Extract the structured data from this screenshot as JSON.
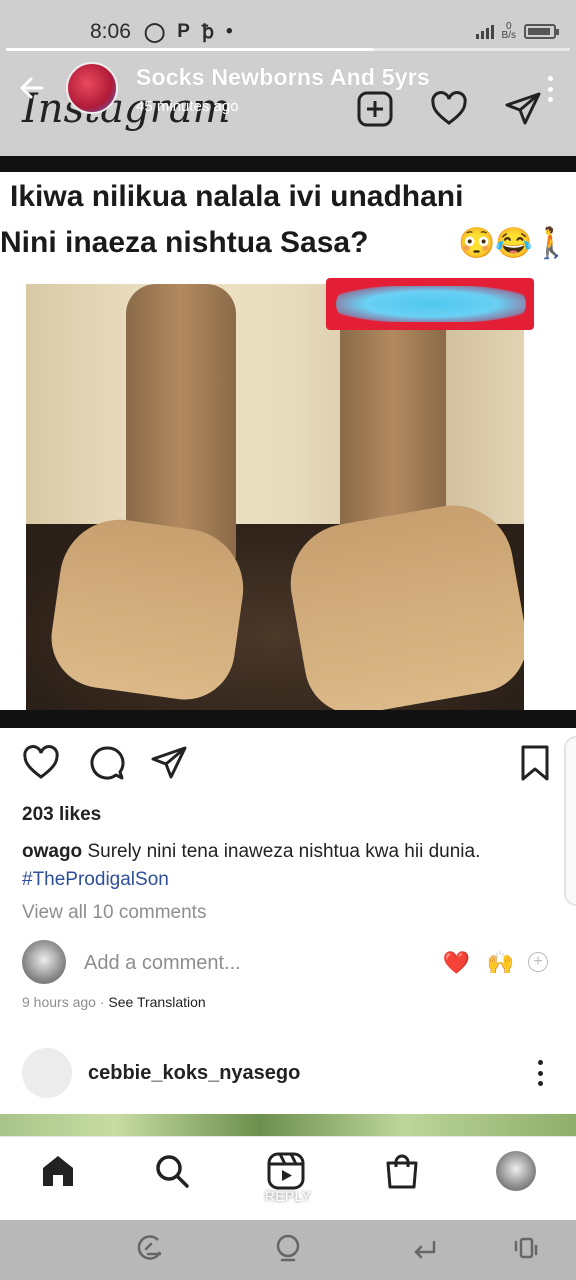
{
  "status_bar": {
    "time": "8:06",
    "left_icons": [
      "status-ring-icon",
      "p-icon",
      "hotspot-icon",
      "dot-icon"
    ],
    "net_speed_value": "0",
    "net_speed_unit": "B/s"
  },
  "story": {
    "title": "Socks Newborns And 5yrs",
    "time_ago": "45 minutes ago",
    "progress": 0.65
  },
  "instagram": {
    "logo_text": "Instagram"
  },
  "post": {
    "headline_line1": "Ikiwa nilikua nalala ivi unadhani",
    "headline_line2": "Nini inaeza nishtua Sasa?",
    "headline_emojis": "😳😂🚶",
    "likes": "203 likes",
    "caption_user": "owago",
    "caption_text": " Surely nini tena inaweza nishtua kwa hii dunia.",
    "hashtag": "#TheProdigalSon",
    "view_comments": "View all 10 comments",
    "add_comment_placeholder": "Add a comment...",
    "quick_emoji_1": "❤️",
    "quick_emoji_2": "🙌",
    "timestamp": "9 hours ago",
    "separator": " · ",
    "see_translation": "See Translation"
  },
  "next_post": {
    "username": "cebbie_koks_nyasego"
  },
  "bottom_nav": {
    "reply_label": "REPLY"
  },
  "colors": {
    "hashtag": "#2d4e9a",
    "like_heart": "#e41e35",
    "sticker_red": "#e41e35",
    "sticker_blue": "#4fc7f0"
  }
}
